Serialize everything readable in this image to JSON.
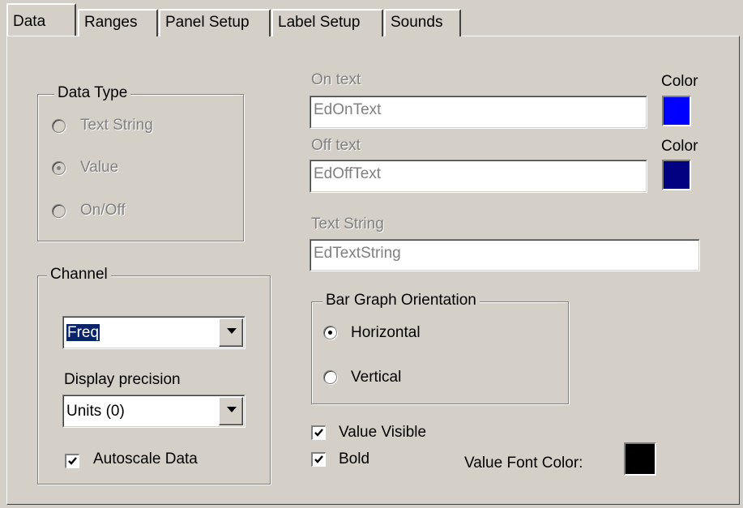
{
  "tabs": [
    "Data",
    "Ranges",
    "Panel Setup",
    "Label Setup",
    "Sounds"
  ],
  "active_tab": "Data",
  "data_type": {
    "legend": "Data Type",
    "options": [
      "Text String",
      "Value",
      "On/Off"
    ],
    "selected": "Value"
  },
  "on_text": {
    "label": "On text",
    "value": "EdOnText",
    "color_label": "Color",
    "color": "#0000ff"
  },
  "off_text": {
    "label": "Off text",
    "value": "EdOffText",
    "color_label": "Color",
    "color": "#000080"
  },
  "text_string": {
    "label": "Text String",
    "value": "EdTextString"
  },
  "channel": {
    "legend": "Channel",
    "selected": "Freq",
    "precision_label": "Display precision",
    "precision_value": "Units (0)",
    "autoscale_label": "Autoscale Data",
    "autoscale_checked": true
  },
  "bar_graph": {
    "legend": "Bar Graph Orientation",
    "options": [
      "Horizontal",
      "Vertical"
    ],
    "selected": "Horizontal"
  },
  "value_visible": {
    "label": "Value Visible",
    "checked": true
  },
  "bold": {
    "label": "Bold",
    "checked": true
  },
  "value_font_color": {
    "label": "Value Font Color:",
    "color": "#000000"
  }
}
